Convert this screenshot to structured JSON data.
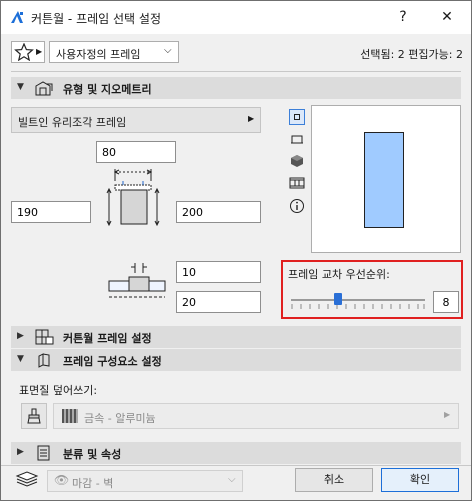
{
  "window": {
    "title": "커튼월 - 프레임 선택 설정",
    "help": "?",
    "close": "✕"
  },
  "favorites": {
    "dropdown_value": "사용자정의 프레임",
    "status": "선택됨: 2 편집가능: 2"
  },
  "sections": {
    "type_geometry": "유형 및 지오메트리",
    "curtainwall_frame": "커튼월 프레임 설정",
    "frame_components": "프레임 구성요소 설정",
    "classification": "분류 및 속성"
  },
  "frame_type": {
    "value": "빌트인 유리조각 프레임"
  },
  "dimensions": {
    "top": "80",
    "left": "190",
    "right": "200",
    "offset_a": "10",
    "offset_b": "20"
  },
  "priority": {
    "label": "프레임 교차 우선순위:",
    "value": "8",
    "slider_fraction": 0.35
  },
  "surface": {
    "label": "표면질 덮어쓰기:",
    "material": "금속 - 알루미늄"
  },
  "footer": {
    "layer": "마감 - 벽",
    "cancel": "취소",
    "ok": "확인"
  },
  "colors": {
    "preview_fill": "#a0cbff",
    "highlight_border": "#e02020",
    "slider_thumb": "#2a6fd6"
  }
}
